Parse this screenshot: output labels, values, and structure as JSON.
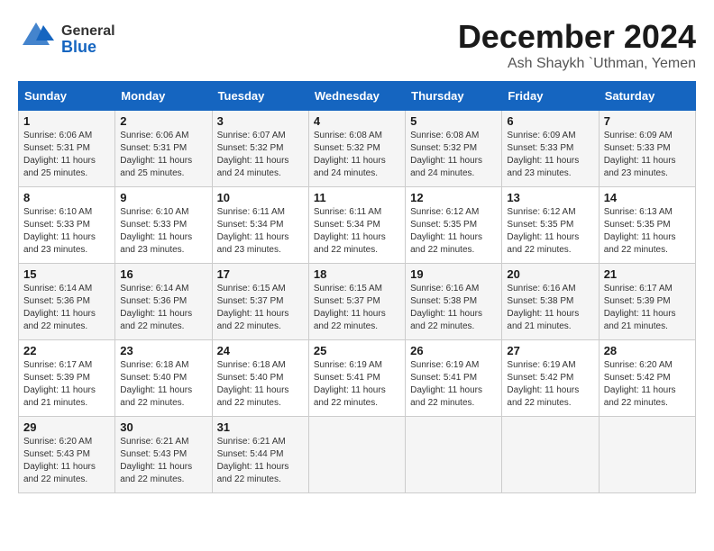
{
  "header": {
    "logo": {
      "general": "General",
      "blue": "Blue"
    },
    "month": "December 2024",
    "location": "Ash Shaykh `Uthman, Yemen"
  },
  "weekdays": [
    "Sunday",
    "Monday",
    "Tuesday",
    "Wednesday",
    "Thursday",
    "Friday",
    "Saturday"
  ],
  "weeks": [
    [
      {
        "day": "1",
        "sunrise": "6:06 AM",
        "sunset": "5:31 PM",
        "daylight": "11 hours and 25 minutes."
      },
      {
        "day": "2",
        "sunrise": "6:06 AM",
        "sunset": "5:31 PM",
        "daylight": "11 hours and 25 minutes."
      },
      {
        "day": "3",
        "sunrise": "6:07 AM",
        "sunset": "5:32 PM",
        "daylight": "11 hours and 24 minutes."
      },
      {
        "day": "4",
        "sunrise": "6:08 AM",
        "sunset": "5:32 PM",
        "daylight": "11 hours and 24 minutes."
      },
      {
        "day": "5",
        "sunrise": "6:08 AM",
        "sunset": "5:32 PM",
        "daylight": "11 hours and 24 minutes."
      },
      {
        "day": "6",
        "sunrise": "6:09 AM",
        "sunset": "5:33 PM",
        "daylight": "11 hours and 23 minutes."
      },
      {
        "day": "7",
        "sunrise": "6:09 AM",
        "sunset": "5:33 PM",
        "daylight": "11 hours and 23 minutes."
      }
    ],
    [
      {
        "day": "8",
        "sunrise": "6:10 AM",
        "sunset": "5:33 PM",
        "daylight": "11 hours and 23 minutes."
      },
      {
        "day": "9",
        "sunrise": "6:10 AM",
        "sunset": "5:33 PM",
        "daylight": "11 hours and 23 minutes."
      },
      {
        "day": "10",
        "sunrise": "6:11 AM",
        "sunset": "5:34 PM",
        "daylight": "11 hours and 23 minutes."
      },
      {
        "day": "11",
        "sunrise": "6:11 AM",
        "sunset": "5:34 PM",
        "daylight": "11 hours and 22 minutes."
      },
      {
        "day": "12",
        "sunrise": "6:12 AM",
        "sunset": "5:35 PM",
        "daylight": "11 hours and 22 minutes."
      },
      {
        "day": "13",
        "sunrise": "6:12 AM",
        "sunset": "5:35 PM",
        "daylight": "11 hours and 22 minutes."
      },
      {
        "day": "14",
        "sunrise": "6:13 AM",
        "sunset": "5:35 PM",
        "daylight": "11 hours and 22 minutes."
      }
    ],
    [
      {
        "day": "15",
        "sunrise": "6:14 AM",
        "sunset": "5:36 PM",
        "daylight": "11 hours and 22 minutes."
      },
      {
        "day": "16",
        "sunrise": "6:14 AM",
        "sunset": "5:36 PM",
        "daylight": "11 hours and 22 minutes."
      },
      {
        "day": "17",
        "sunrise": "6:15 AM",
        "sunset": "5:37 PM",
        "daylight": "11 hours and 22 minutes."
      },
      {
        "day": "18",
        "sunrise": "6:15 AM",
        "sunset": "5:37 PM",
        "daylight": "11 hours and 22 minutes."
      },
      {
        "day": "19",
        "sunrise": "6:16 AM",
        "sunset": "5:38 PM",
        "daylight": "11 hours and 22 minutes."
      },
      {
        "day": "20",
        "sunrise": "6:16 AM",
        "sunset": "5:38 PM",
        "daylight": "11 hours and 21 minutes."
      },
      {
        "day": "21",
        "sunrise": "6:17 AM",
        "sunset": "5:39 PM",
        "daylight": "11 hours and 21 minutes."
      }
    ],
    [
      {
        "day": "22",
        "sunrise": "6:17 AM",
        "sunset": "5:39 PM",
        "daylight": "11 hours and 21 minutes."
      },
      {
        "day": "23",
        "sunrise": "6:18 AM",
        "sunset": "5:40 PM",
        "daylight": "11 hours and 22 minutes."
      },
      {
        "day": "24",
        "sunrise": "6:18 AM",
        "sunset": "5:40 PM",
        "daylight": "11 hours and 22 minutes."
      },
      {
        "day": "25",
        "sunrise": "6:19 AM",
        "sunset": "5:41 PM",
        "daylight": "11 hours and 22 minutes."
      },
      {
        "day": "26",
        "sunrise": "6:19 AM",
        "sunset": "5:41 PM",
        "daylight": "11 hours and 22 minutes."
      },
      {
        "day": "27",
        "sunrise": "6:19 AM",
        "sunset": "5:42 PM",
        "daylight": "11 hours and 22 minutes."
      },
      {
        "day": "28",
        "sunrise": "6:20 AM",
        "sunset": "5:42 PM",
        "daylight": "11 hours and 22 minutes."
      }
    ],
    [
      {
        "day": "29",
        "sunrise": "6:20 AM",
        "sunset": "5:43 PM",
        "daylight": "11 hours and 22 minutes."
      },
      {
        "day": "30",
        "sunrise": "6:21 AM",
        "sunset": "5:43 PM",
        "daylight": "11 hours and 22 minutes."
      },
      {
        "day": "31",
        "sunrise": "6:21 AM",
        "sunset": "5:44 PM",
        "daylight": "11 hours and 22 minutes."
      },
      null,
      null,
      null,
      null
    ]
  ]
}
